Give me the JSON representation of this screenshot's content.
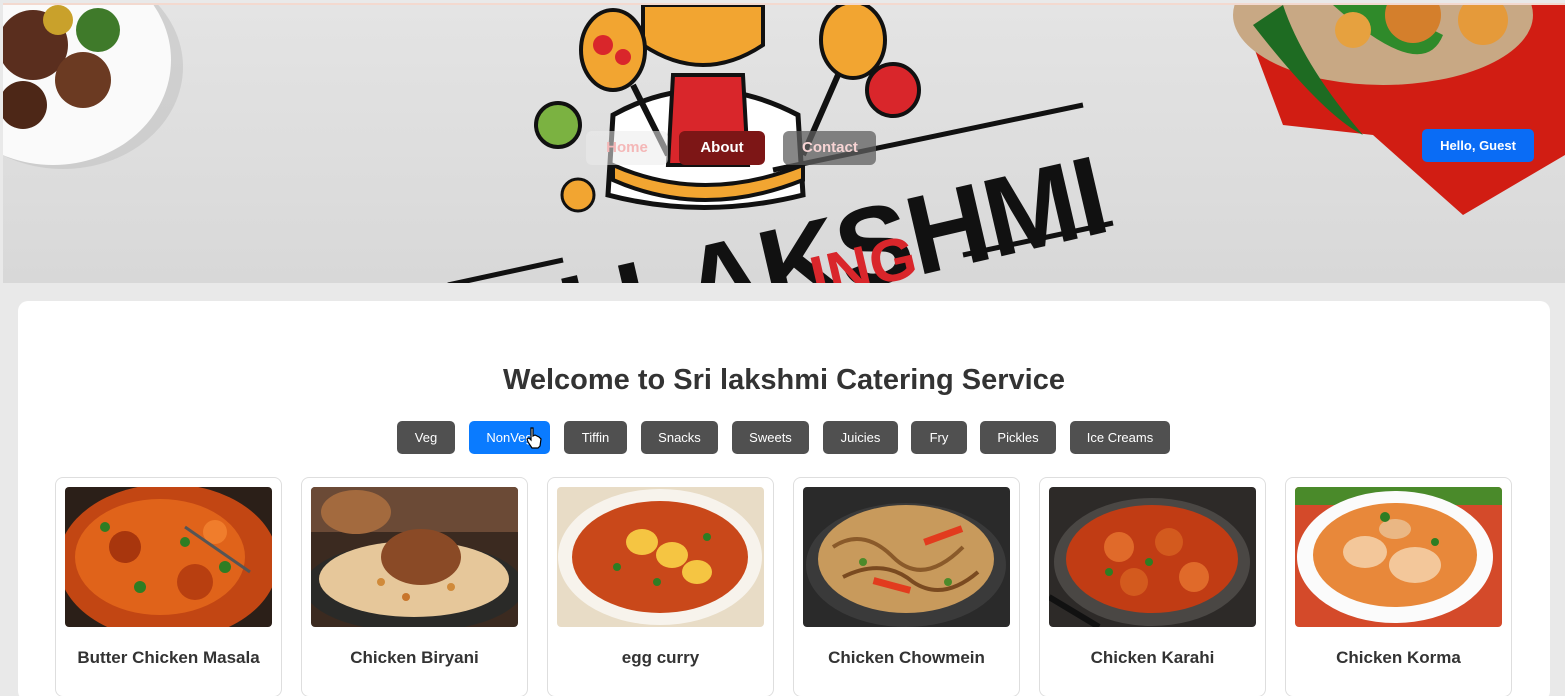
{
  "nav": {
    "home_label": "Home",
    "about_label": "About",
    "contact_label": "Contact"
  },
  "user": {
    "greeting": "Hello, Guest"
  },
  "banner": {
    "logo_text": "RI LAKSHMI",
    "logo_subtext": "ING"
  },
  "main": {
    "title": "Welcome to Sri lakshmi Catering Service"
  },
  "categories": [
    {
      "label": "Veg",
      "active": false
    },
    {
      "label": "NonVeg",
      "active": true
    },
    {
      "label": "Tiffin",
      "active": false
    },
    {
      "label": "Snacks",
      "active": false
    },
    {
      "label": "Sweets",
      "active": false
    },
    {
      "label": "Juicies",
      "active": false
    },
    {
      "label": "Fry",
      "active": false
    },
    {
      "label": "Pickles",
      "active": false
    },
    {
      "label": "Ice Creams",
      "active": false
    }
  ],
  "dishes": [
    {
      "name": "Butter Chicken Masala"
    },
    {
      "name": "Chicken Biryani"
    },
    {
      "name": "egg curry"
    },
    {
      "name": "Chicken Chowmein"
    },
    {
      "name": "Chicken Karahi"
    },
    {
      "name": "Chicken Korma"
    }
  ],
  "colors": {
    "primary_blue": "#0a7bff",
    "category_gray": "#505050",
    "about_red": "#7d1616",
    "text_dark": "#333333"
  }
}
